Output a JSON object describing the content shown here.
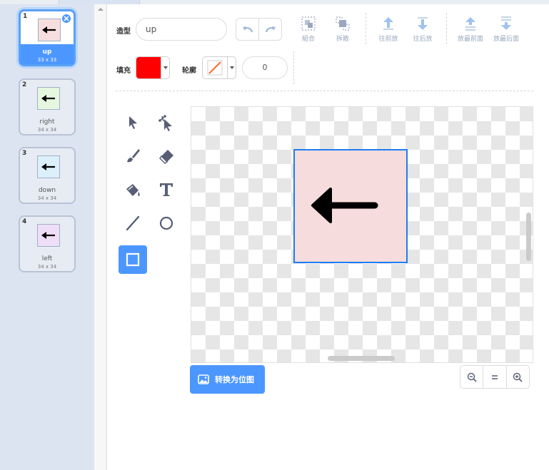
{
  "toolbar": {
    "costume_label": "造型",
    "costume_name": "up",
    "group_label": "組合",
    "ungroup_label": "拆散",
    "forward_label": "往前放",
    "backward_label": "往后放",
    "front_label": "放最前面",
    "back_label": "放最后面",
    "fill_label": "填充",
    "outline_label": "轮廓",
    "fill_color": "#ff0000",
    "outline_width": "0"
  },
  "costumes": [
    {
      "number": "1",
      "name": "up",
      "size": "33 x 33",
      "thumb_bg": "#f7dede",
      "selected": true
    },
    {
      "number": "2",
      "name": "right",
      "size": "34 x 34",
      "thumb_bg": "#e5f7df",
      "selected": false
    },
    {
      "number": "3",
      "name": "down",
      "size": "34 x 34",
      "thumb_bg": "#dcf0fb",
      "selected": false
    },
    {
      "number": "4",
      "name": "left",
      "size": "34 x 34",
      "thumb_bg": "#efdef7",
      "selected": false
    }
  ],
  "canvas": {
    "artwork_bg": "#f6dcdc",
    "selection_color": "#1f7cf2"
  },
  "bottom": {
    "convert_label": "转换为位图"
  },
  "colors": {
    "accent": "#4c97ff",
    "sidebar_bg": "#dde4f1",
    "disabled_icon": "#9aa8bf"
  }
}
